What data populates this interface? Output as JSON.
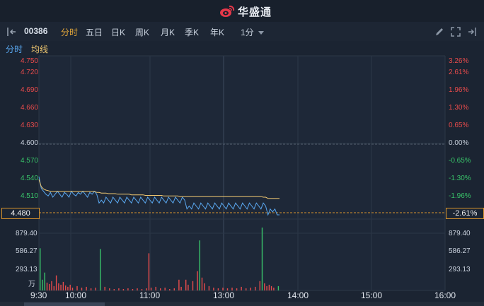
{
  "brand": {
    "name": "华盛通",
    "logo_icon": "weibo-like-logo-icon"
  },
  "toolbar": {
    "stock_code": "00386",
    "tabs": [
      "分时",
      "五日",
      "日K",
      "周K",
      "月K",
      "季K",
      "年K"
    ],
    "active_tab": "分时",
    "interval": "1分"
  },
  "subbar": {
    "items": [
      "分时",
      "均线"
    ]
  },
  "price_axis": {
    "left": [
      "4.750",
      "4.720",
      "4.690",
      "4.660",
      "4.630",
      "4.600",
      "4.570",
      "4.540",
      "4.510"
    ],
    "right": [
      "3.26%",
      "2.61%",
      "1.96%",
      "1.30%",
      "0.65%",
      "0.00%",
      "-0.65%",
      "-1.30%",
      "-1.96%"
    ],
    "current_price": "4.480",
    "current_pct": "-2.61%"
  },
  "volume_axis": {
    "left": [
      "879.40",
      "586.27",
      "293.13"
    ],
    "right": [
      "879.40",
      "586.27",
      "293.13"
    ],
    "unit": "万"
  },
  "time_axis": [
    "9:30",
    "10:00",
    "11:00",
    "13:00",
    "14:00",
    "15:00",
    "16:00"
  ],
  "colors": {
    "up": "#e84b4b",
    "down": "#39c46a",
    "price_line": "#5aa8f0",
    "avg_line": "#f0c870",
    "accent": "#e7a93a"
  },
  "chart_data": {
    "type": "line",
    "prev_close": 4.6,
    "ylim": [
      4.48,
      4.75
    ],
    "series": [
      {
        "name": "分时",
        "values": [
          4.545,
          4.525,
          4.52,
          4.515,
          4.512,
          4.518,
          4.51,
          4.515,
          4.52,
          4.515,
          4.51,
          4.518,
          4.515,
          4.51,
          4.52,
          4.515,
          4.512,
          4.518,
          4.515,
          4.52,
          4.515,
          4.51,
          4.518,
          4.515,
          4.52,
          4.515,
          4.5,
          4.505,
          4.5,
          4.51,
          4.505,
          4.5,
          4.51,
          4.505,
          4.5,
          4.51,
          4.505,
          4.5,
          4.51,
          4.505,
          4.5,
          4.51,
          4.505,
          4.5,
          4.51,
          4.505,
          4.5,
          4.51,
          4.505,
          4.5,
          4.51,
          4.505,
          4.5,
          4.51,
          4.505,
          4.5,
          4.51,
          4.505,
          4.5,
          4.51,
          4.505,
          4.5,
          4.51,
          4.505,
          4.49,
          4.495,
          4.49,
          4.5,
          4.495,
          4.49,
          4.5,
          4.495,
          4.49,
          4.5,
          4.495,
          4.49,
          4.5,
          4.495,
          4.49,
          4.5,
          4.495,
          4.49,
          4.5,
          4.495,
          4.49,
          4.5,
          4.495,
          4.49,
          4.5,
          4.495,
          4.49,
          4.5,
          4.495,
          4.49,
          4.5,
          4.495,
          4.49,
          4.5,
          4.495,
          4.48,
          4.49,
          4.485,
          4.49,
          4.48,
          4.48
        ]
      },
      {
        "name": "均线",
        "values": [
          4.54,
          4.528,
          4.524,
          4.522,
          4.521,
          4.52,
          4.52,
          4.52,
          4.52,
          4.52,
          4.52,
          4.52,
          4.52,
          4.52,
          4.52,
          4.52,
          4.52,
          4.52,
          4.52,
          4.52,
          4.52,
          4.52,
          4.52,
          4.52,
          4.52,
          4.518,
          4.518,
          4.517,
          4.517,
          4.517,
          4.516,
          4.516,
          4.516,
          4.516,
          4.515,
          4.515,
          4.515,
          4.515,
          4.515,
          4.515,
          4.514,
          4.514,
          4.514,
          4.514,
          4.514,
          4.514,
          4.513,
          4.513,
          4.513,
          4.513,
          4.513,
          4.513,
          4.513,
          4.513,
          4.512,
          4.512,
          4.512,
          4.512,
          4.512,
          4.512,
          4.512,
          4.511,
          4.511,
          4.511,
          4.511,
          4.511,
          4.511,
          4.511,
          4.511,
          4.511,
          4.511,
          4.511,
          4.511,
          4.511,
          4.511,
          4.511,
          4.511,
          4.511,
          4.511,
          4.511,
          4.511,
          4.511,
          4.511,
          4.511,
          4.511,
          4.511,
          4.511,
          4.511,
          4.511,
          4.511,
          4.511,
          4.511,
          4.511,
          4.511,
          4.511,
          4.511,
          4.511,
          4.51,
          4.51,
          4.508,
          4.508,
          4.508,
          4.508,
          4.508,
          4.508
        ]
      }
    ],
    "volume": {
      "ylim": [
        0,
        879.4
      ],
      "bars": [
        {
          "i": 0,
          "v": 590,
          "d": "down"
        },
        {
          "i": 1,
          "v": 150,
          "d": "down"
        },
        {
          "i": 2,
          "v": 250,
          "d": "down"
        },
        {
          "i": 3,
          "v": 110,
          "d": "up"
        },
        {
          "i": 4,
          "v": 90,
          "d": "up"
        },
        {
          "i": 5,
          "v": 130,
          "d": "up"
        },
        {
          "i": 6,
          "v": 60,
          "d": "up"
        },
        {
          "i": 7,
          "v": 210,
          "d": "up"
        },
        {
          "i": 8,
          "v": 100,
          "d": "up"
        },
        {
          "i": 9,
          "v": 80,
          "d": "up"
        },
        {
          "i": 10,
          "v": 120,
          "d": "up"
        },
        {
          "i": 11,
          "v": 70,
          "d": "up"
        },
        {
          "i": 12,
          "v": 50,
          "d": "up"
        },
        {
          "i": 13,
          "v": 80,
          "d": "up"
        },
        {
          "i": 14,
          "v": 40,
          "d": "up"
        },
        {
          "i": 16,
          "v": 60,
          "d": "up"
        },
        {
          "i": 18,
          "v": 40,
          "d": "up"
        },
        {
          "i": 20,
          "v": 50,
          "d": "up"
        },
        {
          "i": 22,
          "v": 30,
          "d": "up"
        },
        {
          "i": 24,
          "v": 40,
          "d": "up"
        },
        {
          "i": 26,
          "v": 580,
          "d": "down"
        },
        {
          "i": 28,
          "v": 50,
          "d": "up"
        },
        {
          "i": 30,
          "v": 30,
          "d": "up"
        },
        {
          "i": 32,
          "v": 20,
          "d": "up"
        },
        {
          "i": 34,
          "v": 30,
          "d": "up"
        },
        {
          "i": 36,
          "v": 20,
          "d": "up"
        },
        {
          "i": 38,
          "v": 30,
          "d": "up"
        },
        {
          "i": 40,
          "v": 20,
          "d": "up"
        },
        {
          "i": 42,
          "v": 30,
          "d": "up"
        },
        {
          "i": 44,
          "v": 20,
          "d": "up"
        },
        {
          "i": 46,
          "v": 30,
          "d": "up"
        },
        {
          "i": 47,
          "v": 520,
          "d": "up"
        },
        {
          "i": 48,
          "v": 40,
          "d": "up"
        },
        {
          "i": 50,
          "v": 50,
          "d": "up"
        },
        {
          "i": 52,
          "v": 30,
          "d": "up"
        },
        {
          "i": 54,
          "v": 40,
          "d": "up"
        },
        {
          "i": 56,
          "v": 20,
          "d": "up"
        },
        {
          "i": 58,
          "v": 30,
          "d": "up"
        },
        {
          "i": 60,
          "v": 150,
          "d": "up"
        },
        {
          "i": 61,
          "v": 50,
          "d": "up"
        },
        {
          "i": 63,
          "v": 150,
          "d": "up"
        },
        {
          "i": 64,
          "v": 80,
          "d": "up"
        },
        {
          "i": 66,
          "v": 130,
          "d": "up"
        },
        {
          "i": 68,
          "v": 270,
          "d": "up"
        },
        {
          "i": 69,
          "v": 700,
          "d": "down"
        },
        {
          "i": 70,
          "v": 180,
          "d": "up"
        },
        {
          "i": 71,
          "v": 100,
          "d": "up"
        },
        {
          "i": 73,
          "v": 60,
          "d": "up"
        },
        {
          "i": 75,
          "v": 40,
          "d": "up"
        },
        {
          "i": 77,
          "v": 30,
          "d": "up"
        },
        {
          "i": 79,
          "v": 40,
          "d": "up"
        },
        {
          "i": 81,
          "v": 30,
          "d": "up"
        },
        {
          "i": 83,
          "v": 40,
          "d": "up"
        },
        {
          "i": 85,
          "v": 30,
          "d": "up"
        },
        {
          "i": 87,
          "v": 50,
          "d": "up"
        },
        {
          "i": 89,
          "v": 30,
          "d": "up"
        },
        {
          "i": 91,
          "v": 40,
          "d": "up"
        },
        {
          "i": 93,
          "v": 50,
          "d": "up"
        },
        {
          "i": 95,
          "v": 130,
          "d": "up"
        },
        {
          "i": 96,
          "v": 880,
          "d": "down"
        },
        {
          "i": 97,
          "v": 100,
          "d": "up"
        },
        {
          "i": 98,
          "v": 60,
          "d": "up"
        },
        {
          "i": 99,
          "v": 80,
          "d": "up"
        },
        {
          "i": 100,
          "v": 60,
          "d": "up"
        },
        {
          "i": 101,
          "v": 40,
          "d": "up"
        },
        {
          "i": 103,
          "v": 60,
          "d": "down"
        }
      ]
    }
  }
}
